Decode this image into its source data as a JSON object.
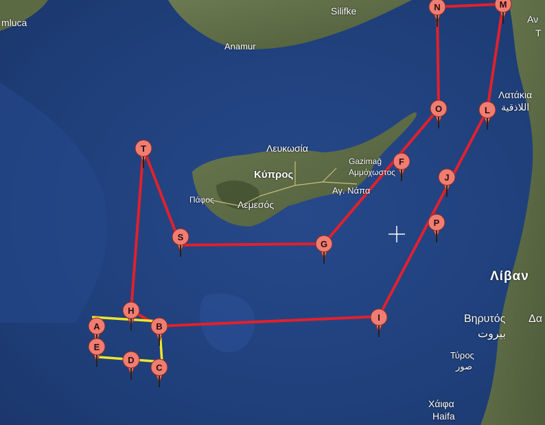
{
  "map": {
    "place_labels": {
      "amluca": "mluca",
      "silifke": "Silifke",
      "anamur": "Anamur",
      "lefkosia": "Λευκωσία",
      "kypros": "Κύπρος",
      "gazimagusa": "Gazimağ",
      "ammochostos": "Αμμόχωστος",
      "agia_napa": "Αγ. Νάπα",
      "pafos": "Πάφος",
      "lemesos": "Λεμεσός",
      "lattakia": "Λατάκια",
      "lattakia_ar": "اللاذقية",
      "antakya_partial": "Αν",
      "t_partial": "T",
      "livanos": "Λίβαν",
      "beirut_gr": "Βηρυτός",
      "beirut_ar": "بيروت",
      "damascus_partial": "Δα",
      "tyros": "Τύρος",
      "tyros_ar": "صور",
      "haifa_gr": "Χάιφα",
      "haifa": "Haifa"
    },
    "markers": [
      "N",
      "M",
      "O",
      "L",
      "T",
      "F",
      "J",
      "S",
      "P",
      "G",
      "H",
      "I",
      "A",
      "B",
      "E",
      "D",
      "C"
    ],
    "colors": {
      "sea": "#1f3f7a",
      "land": "#5a6a45",
      "route": "#e3202c",
      "area": "#f0e62a",
      "marker": "#f07d72"
    }
  }
}
